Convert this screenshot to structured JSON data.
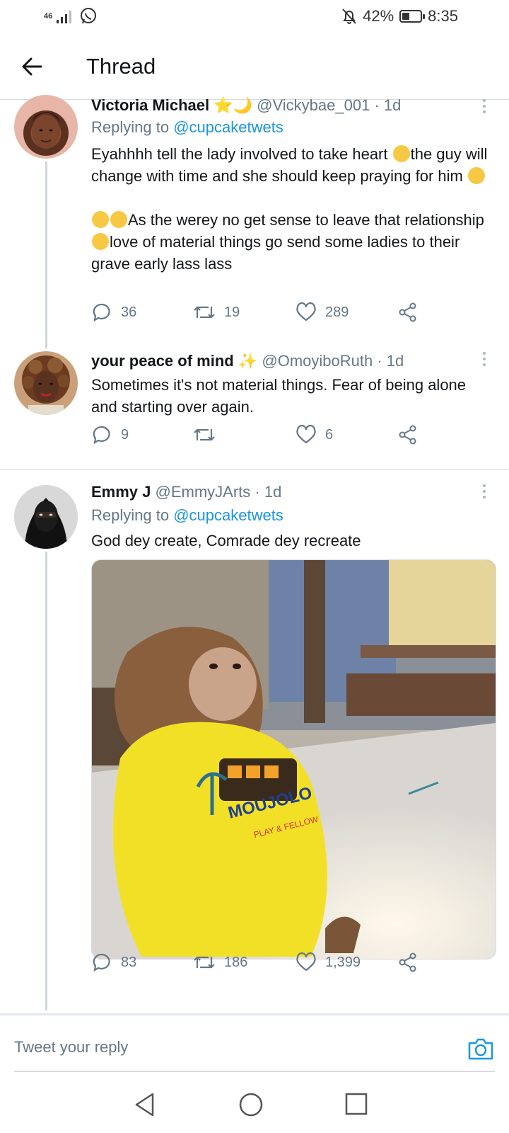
{
  "status_bar": {
    "network": "46",
    "battery": "42%",
    "battery_level": 0.42,
    "time": "8:35"
  },
  "header": {
    "title": "Thread"
  },
  "tweets": [
    {
      "name": "Victoria Michael",
      "handle": "@Vickybae_001",
      "age": "1d",
      "replying_prefix": "Replying to ",
      "replying_to": "@cupcaketwets",
      "para1_a": "Eyahhhh tell the lady involved to take heart ",
      "para1_b": "the guy will change with time and she should keep praying for him ",
      "para2_a": "As the werey no get sense to leave that relationship ",
      "para2_b": "love of material things go send  some ladies to their grave early lass lass",
      "replies": "36",
      "retweets": "19",
      "likes": "289"
    },
    {
      "name": "your peace of mind",
      "handle": "@OmoyiboRuth",
      "age": "1d",
      "text": "Sometimes  it's not material  things. Fear of being  alone and starting  over again.",
      "replies": "9",
      "retweets": "",
      "likes": "6"
    },
    {
      "name": "Emmy J",
      "handle": "@EmmyJArts",
      "age": "1d",
      "replying_prefix": "Replying to ",
      "replying_to": "@cupcaketwets",
      "text": "God dey create, Comrade dey recreate",
      "shirt_text_1": "MOUJOLO",
      "shirt_text_2": "PLAY & FELLOW",
      "replies": "83",
      "retweets": "186",
      "likes": "1,399"
    }
  ],
  "composer": {
    "placeholder": "Tweet your reply"
  },
  "colors": {
    "link": "#1b95e0",
    "muted": "#657786",
    "divider": "#d7dbe0"
  }
}
